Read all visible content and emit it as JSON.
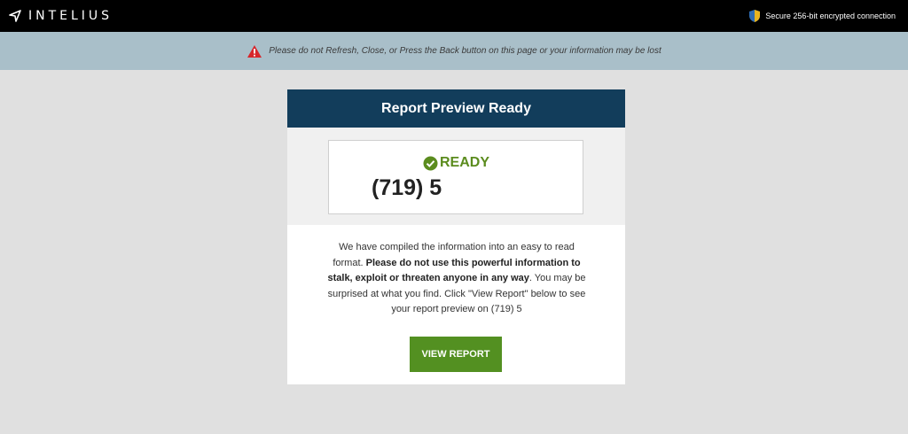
{
  "header": {
    "logo_text": "INTELIUS",
    "logo_icon": "intelius-arrow-icon",
    "secure_text": "Secure 256-bit encrypted connection",
    "secure_icon": "shield-icon",
    "background": "#000000"
  },
  "warning": {
    "icon": "warning-triangle-icon",
    "text": "Please do not Refresh, Close, or Press the Back button on this page or your information may be lost",
    "background": "#a9bfc9"
  },
  "card": {
    "title": "Report Preview Ready",
    "title_background": "#123d5b",
    "status_icon": "check-circle-icon",
    "status_text": "READY",
    "status_color": "#5b8c1e",
    "phone": "(719) 5",
    "message": {
      "part1": "We have compiled the information into an easy to read format. ",
      "bold": "Please do not use this powerful information to stalk, exploit or threaten anyone in any way",
      "part2": ". You may be surprised at what you find. Click \"View Report\" below to see your report preview on (719) 5"
    },
    "button_label": "VIEW REPORT",
    "button_color": "#539021"
  }
}
